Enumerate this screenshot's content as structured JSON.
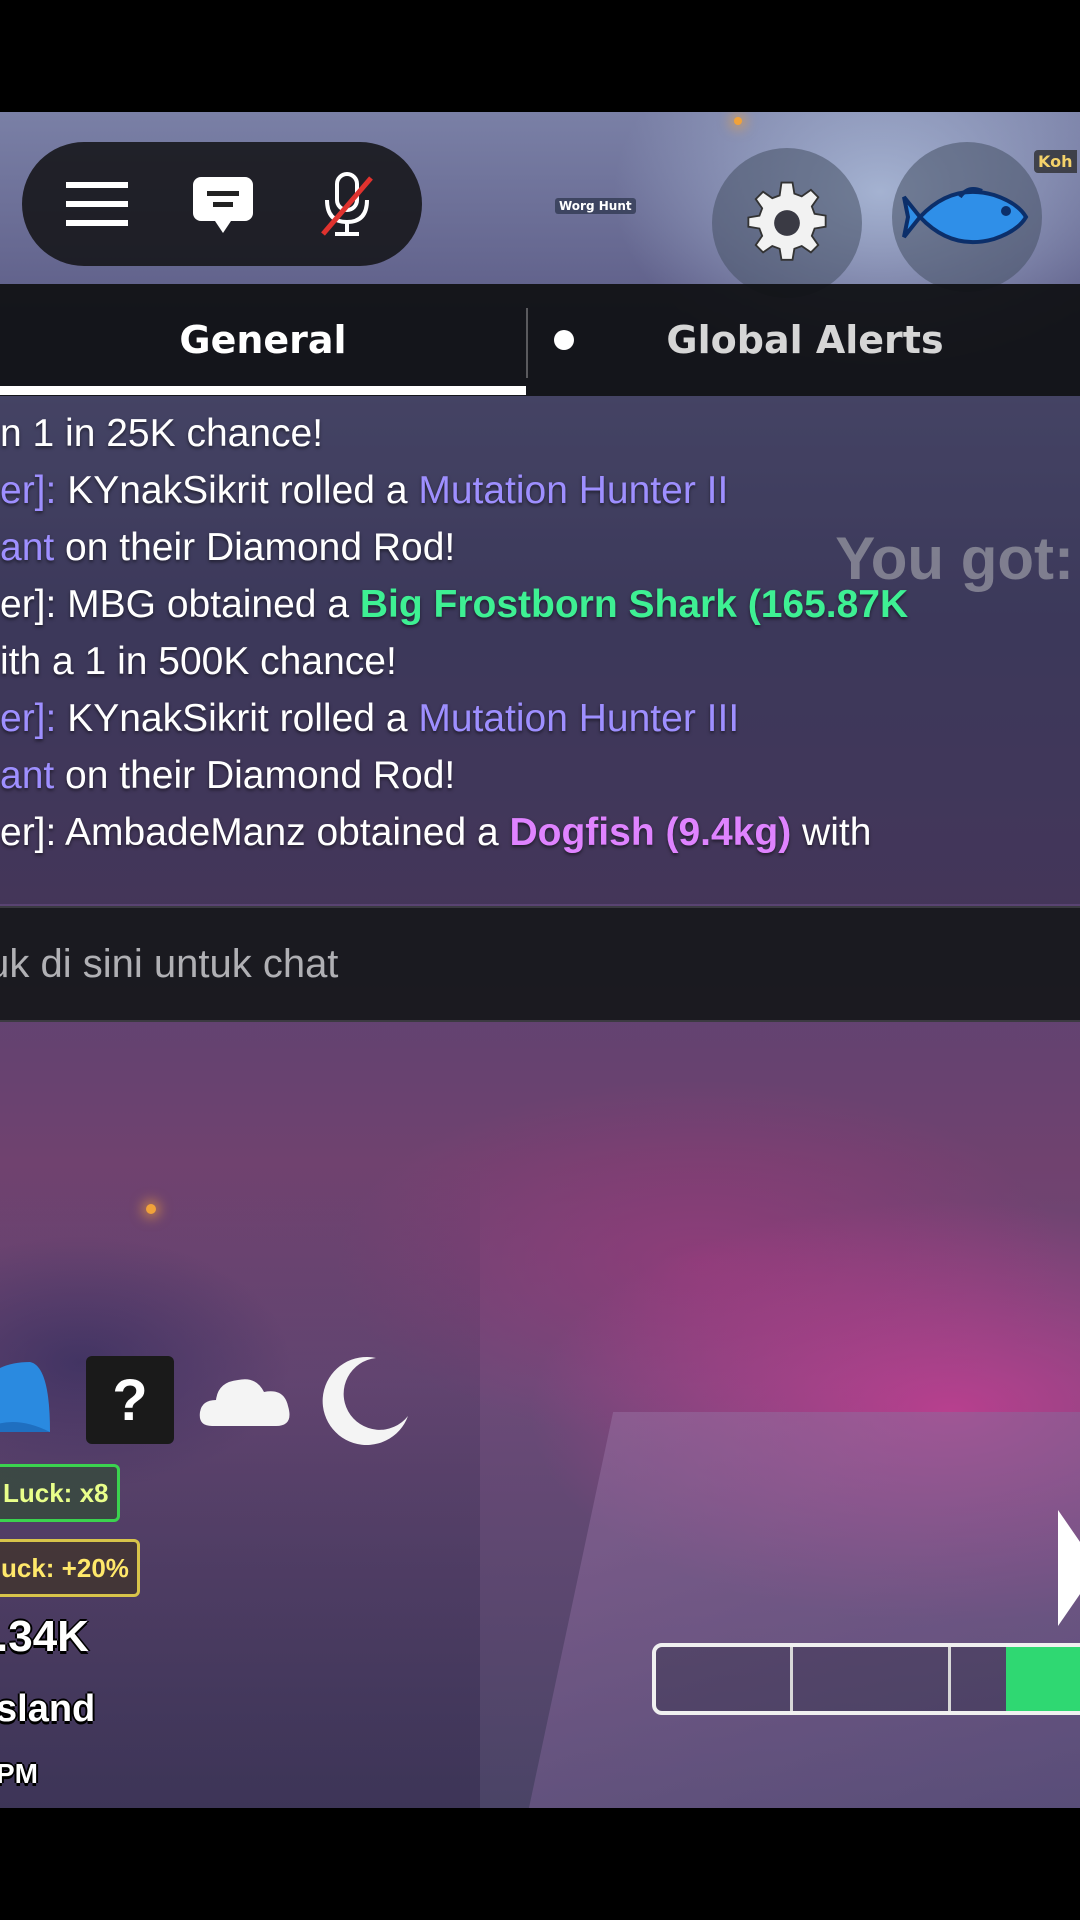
{
  "topbar": {
    "menu_icon": "hamburger-menu-icon",
    "chat_icon": "chat-bubble-icon",
    "mic_icon": "microphone-muted-icon"
  },
  "world": {
    "minimap_label": "Worg Hunt",
    "corner_label": "Koh"
  },
  "hud_buttons": [
    {
      "icon": "gear-icon"
    },
    {
      "icon": "fish-icon"
    }
  ],
  "chat": {
    "tabs": [
      {
        "label": "General",
        "active": true
      },
      {
        "label": "Global Alerts",
        "unread": true
      }
    ],
    "overlay_text": "You got:",
    "lines": [
      [
        {
          "t": "n 1 in 25K chance!",
          "c": ""
        }
      ],
      [
        {
          "t": "er]: ",
          "c": "purple"
        },
        {
          "t": "KYnakSikrit rolled a ",
          "c": ""
        },
        {
          "t": "Mutation Hunter II",
          "c": "purple"
        }
      ],
      [
        {
          "t": "ant",
          "c": "purple"
        },
        {
          "t": " on their Diamond Rod!",
          "c": ""
        }
      ],
      [
        {
          "t": "er]: MBG obtained a ",
          "c": ""
        },
        {
          "t": "Big Frostborn Shark (165.87K",
          "c": "green"
        }
      ],
      [
        {
          "t": "ith a 1 in 500K chance!",
          "c": ""
        }
      ],
      [
        {
          "t": "er]: ",
          "c": "purple"
        },
        {
          "t": "KYnakSikrit rolled a ",
          "c": ""
        },
        {
          "t": "Mutation Hunter III",
          "c": "purple"
        }
      ],
      [
        {
          "t": "ant",
          "c": "purple"
        },
        {
          "t": " on their Diamond Rod!",
          "c": ""
        }
      ],
      [
        {
          "t": "er]: AmbadeManz obtained a ",
          "c": ""
        },
        {
          "t": "Dogfish (9.4kg)",
          "c": "pink"
        },
        {
          "t": " with",
          "c": ""
        }
      ]
    ],
    "input_placeholder": "tuk di sini untuk chat"
  },
  "status": {
    "icons": [
      "umbrella-icon",
      "mystery-box-icon",
      "cloud-icon",
      "moon-icon"
    ],
    "question_mark": "?",
    "luck_badge": "Luck: x8",
    "luck_bonus_badge": "uck: +20%",
    "money": ".34K",
    "location": "sland",
    "time": "PM"
  },
  "catch_progress": 0.24,
  "colors": {
    "accent_green": "#2fd872",
    "mention_purple": "#9e8fff",
    "rare_green": "#3ef093",
    "rare_pink": "#df83ff"
  }
}
